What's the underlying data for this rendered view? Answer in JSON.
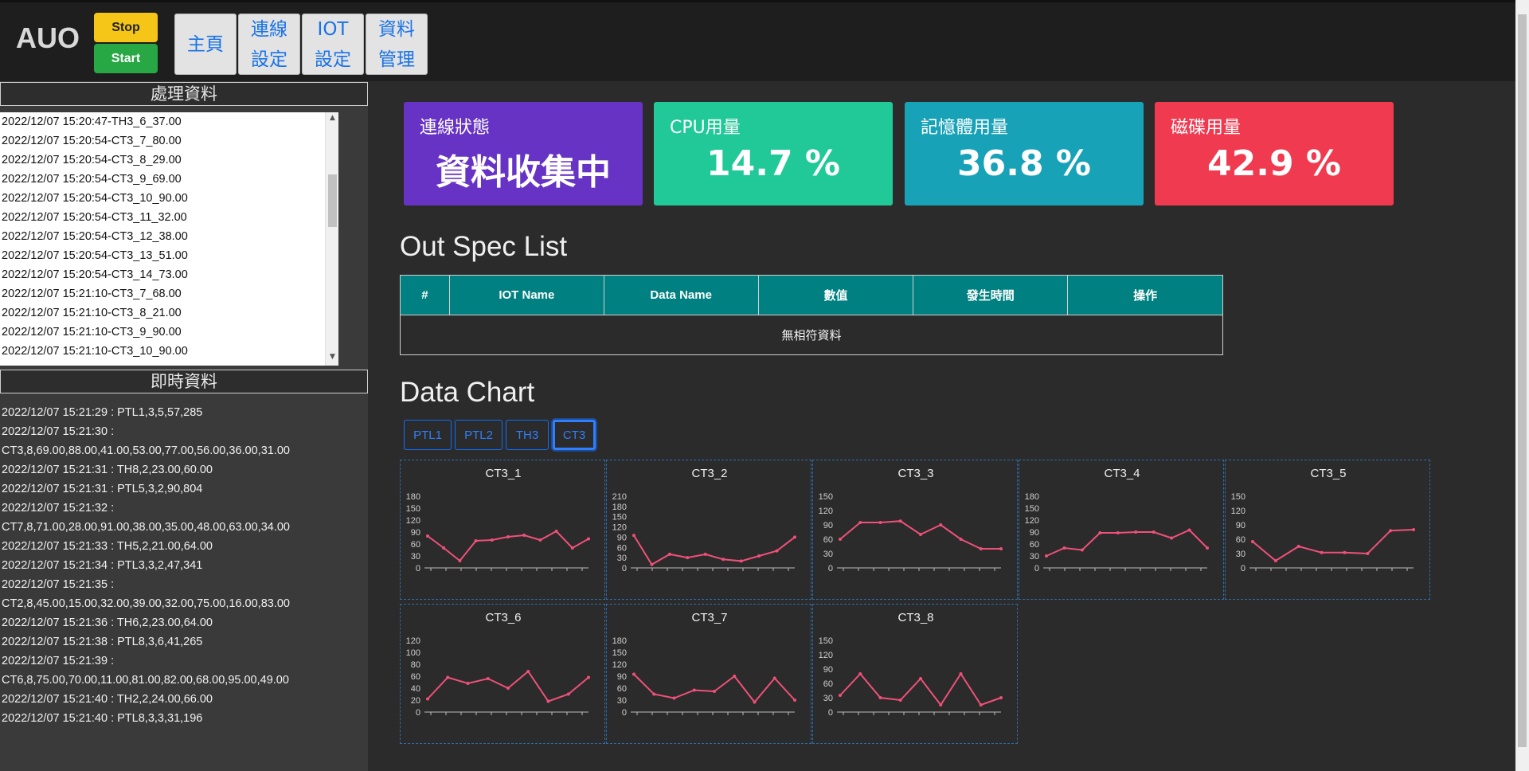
{
  "header": {
    "brand": "AUO",
    "stop_label": "Stop",
    "start_label": "Start",
    "nav": [
      {
        "label": "主頁"
      },
      {
        "label": "連線\n設定"
      },
      {
        "label": "IOT\n設定"
      },
      {
        "label": "資料\n管理"
      }
    ]
  },
  "left": {
    "process_title": "處理資料",
    "process_items": [
      "2022/12/07 15:20:47-TH3_6_37.00",
      "2022/12/07 15:20:54-CT3_7_80.00",
      "2022/12/07 15:20:54-CT3_8_29.00",
      "2022/12/07 15:20:54-CT3_9_69.00",
      "2022/12/07 15:20:54-CT3_10_90.00",
      "2022/12/07 15:20:54-CT3_11_32.00",
      "2022/12/07 15:20:54-CT3_12_38.00",
      "2022/12/07 15:20:54-CT3_13_51.00",
      "2022/12/07 15:20:54-CT3_14_73.00",
      "2022/12/07 15:21:10-CT3_7_68.00",
      "2022/12/07 15:21:10-CT3_8_21.00",
      "2022/12/07 15:21:10-CT3_9_90.00",
      "2022/12/07 15:21:10-CT3_10_90.00"
    ],
    "realtime_title": "即時資料",
    "realtime_lines": [
      "2022/12/07 15:21:29 : PTL1,3,5,57,285",
      "2022/12/07 15:21:30 :",
      "CT3,8,69.00,88.00,41.00,53.00,77.00,56.00,36.00,31.00",
      "2022/12/07 15:21:31 : TH8,2,23.00,60.00",
      "2022/12/07 15:21:31 : PTL5,3,2,90,804",
      "2022/12/07 15:21:32 :",
      "CT7,8,71.00,28.00,91.00,38.00,35.00,48.00,63.00,34.00",
      "2022/12/07 15:21:33 : TH5,2,21.00,64.00",
      "2022/12/07 15:21:34 : PTL3,3,2,47,341",
      "2022/12/07 15:21:35 :",
      "CT2,8,45.00,15.00,32.00,39.00,32.00,75.00,16.00,83.00",
      "2022/12/07 15:21:36 : TH6,2,23.00,64.00",
      "2022/12/07 15:21:38 : PTL8,3,6,41,265",
      "2022/12/07 15:21:39 :",
      "CT6,8,75.00,70.00,11.00,81.00,82.00,68.00,95.00,49.00",
      "2022/12/07 15:21:40 : TH2,2,24.00,66.00",
      "2022/12/07 15:21:40 : PTL8,3,3,31,196"
    ]
  },
  "cards": [
    {
      "title": "連線狀態",
      "value": "資料收集中",
      "color": "#6633c4"
    },
    {
      "title": "CPU用量",
      "value": "14.7 %",
      "color": "#20c997"
    },
    {
      "title": "記憶體用量",
      "value": "36.8 %",
      "color": "#17a2b8"
    },
    {
      "title": "磁碟用量",
      "value": "42.9 %",
      "color": "#f03a4f"
    }
  ],
  "outspec": {
    "title": "Out Spec List",
    "columns": [
      "#",
      "IOT Name",
      "Data Name",
      "數值",
      "發生時間",
      "操作"
    ],
    "empty_text": "無相符資料"
  },
  "datachart": {
    "title": "Data Chart",
    "tabs": [
      "PTL1",
      "PTL2",
      "TH3",
      "CT3"
    ],
    "active_tab": "CT3"
  },
  "chart_data": [
    {
      "type": "line",
      "title": "CT3_1",
      "yticks": [
        0,
        30,
        60,
        90,
        120,
        150,
        180
      ],
      "ylim": [
        0,
        180
      ],
      "values": [
        80,
        50,
        18,
        68,
        70,
        78,
        82,
        70,
        92,
        50,
        73
      ],
      "color": "#f0507a"
    },
    {
      "type": "line",
      "title": "CT3_2",
      "yticks": [
        0,
        30,
        60,
        90,
        120,
        150,
        180,
        210
      ],
      "ylim": [
        0,
        210
      ],
      "values": [
        95,
        10,
        40,
        30,
        40,
        25,
        20,
        35,
        50,
        90
      ],
      "color": "#f0507a"
    },
    {
      "type": "line",
      "title": "CT3_3",
      "yticks": [
        0,
        30,
        60,
        90,
        120,
        150
      ],
      "ylim": [
        0,
        150
      ],
      "values": [
        60,
        95,
        95,
        98,
        70,
        90,
        60,
        40,
        40
      ],
      "color": "#f0507a"
    },
    {
      "type": "line",
      "title": "CT3_4",
      "yticks": [
        0,
        30,
        60,
        90,
        120,
        150,
        180
      ],
      "ylim": [
        0,
        180
      ],
      "values": [
        30,
        50,
        45,
        88,
        88,
        90,
        90,
        75,
        95,
        50
      ],
      "color": "#f0507a"
    },
    {
      "type": "line",
      "title": "CT3_5",
      "yticks": [
        0,
        30,
        60,
        90,
        120,
        150
      ],
      "ylim": [
        0,
        150
      ],
      "values": [
        55,
        15,
        45,
        32,
        32,
        30,
        78,
        80
      ],
      "color": "#f0507a"
    },
    {
      "type": "line",
      "title": "CT3_6",
      "yticks": [
        0,
        20,
        40,
        60,
        80,
        100,
        120
      ],
      "ylim": [
        0,
        120
      ],
      "values": [
        22,
        58,
        48,
        56,
        40,
        68,
        18,
        30,
        58
      ],
      "color": "#f0507a"
    },
    {
      "type": "line",
      "title": "CT3_7",
      "yticks": [
        0,
        30,
        60,
        90,
        120,
        150,
        180
      ],
      "ylim": [
        0,
        180
      ],
      "values": [
        95,
        45,
        35,
        55,
        52,
        90,
        25,
        85,
        30
      ],
      "color": "#f0507a"
    },
    {
      "type": "line",
      "title": "CT3_8",
      "yticks": [
        0,
        30,
        60,
        90,
        120,
        150
      ],
      "ylim": [
        0,
        150
      ],
      "values": [
        35,
        80,
        30,
        25,
        70,
        15,
        80,
        15,
        30
      ],
      "color": "#f0507a"
    }
  ]
}
